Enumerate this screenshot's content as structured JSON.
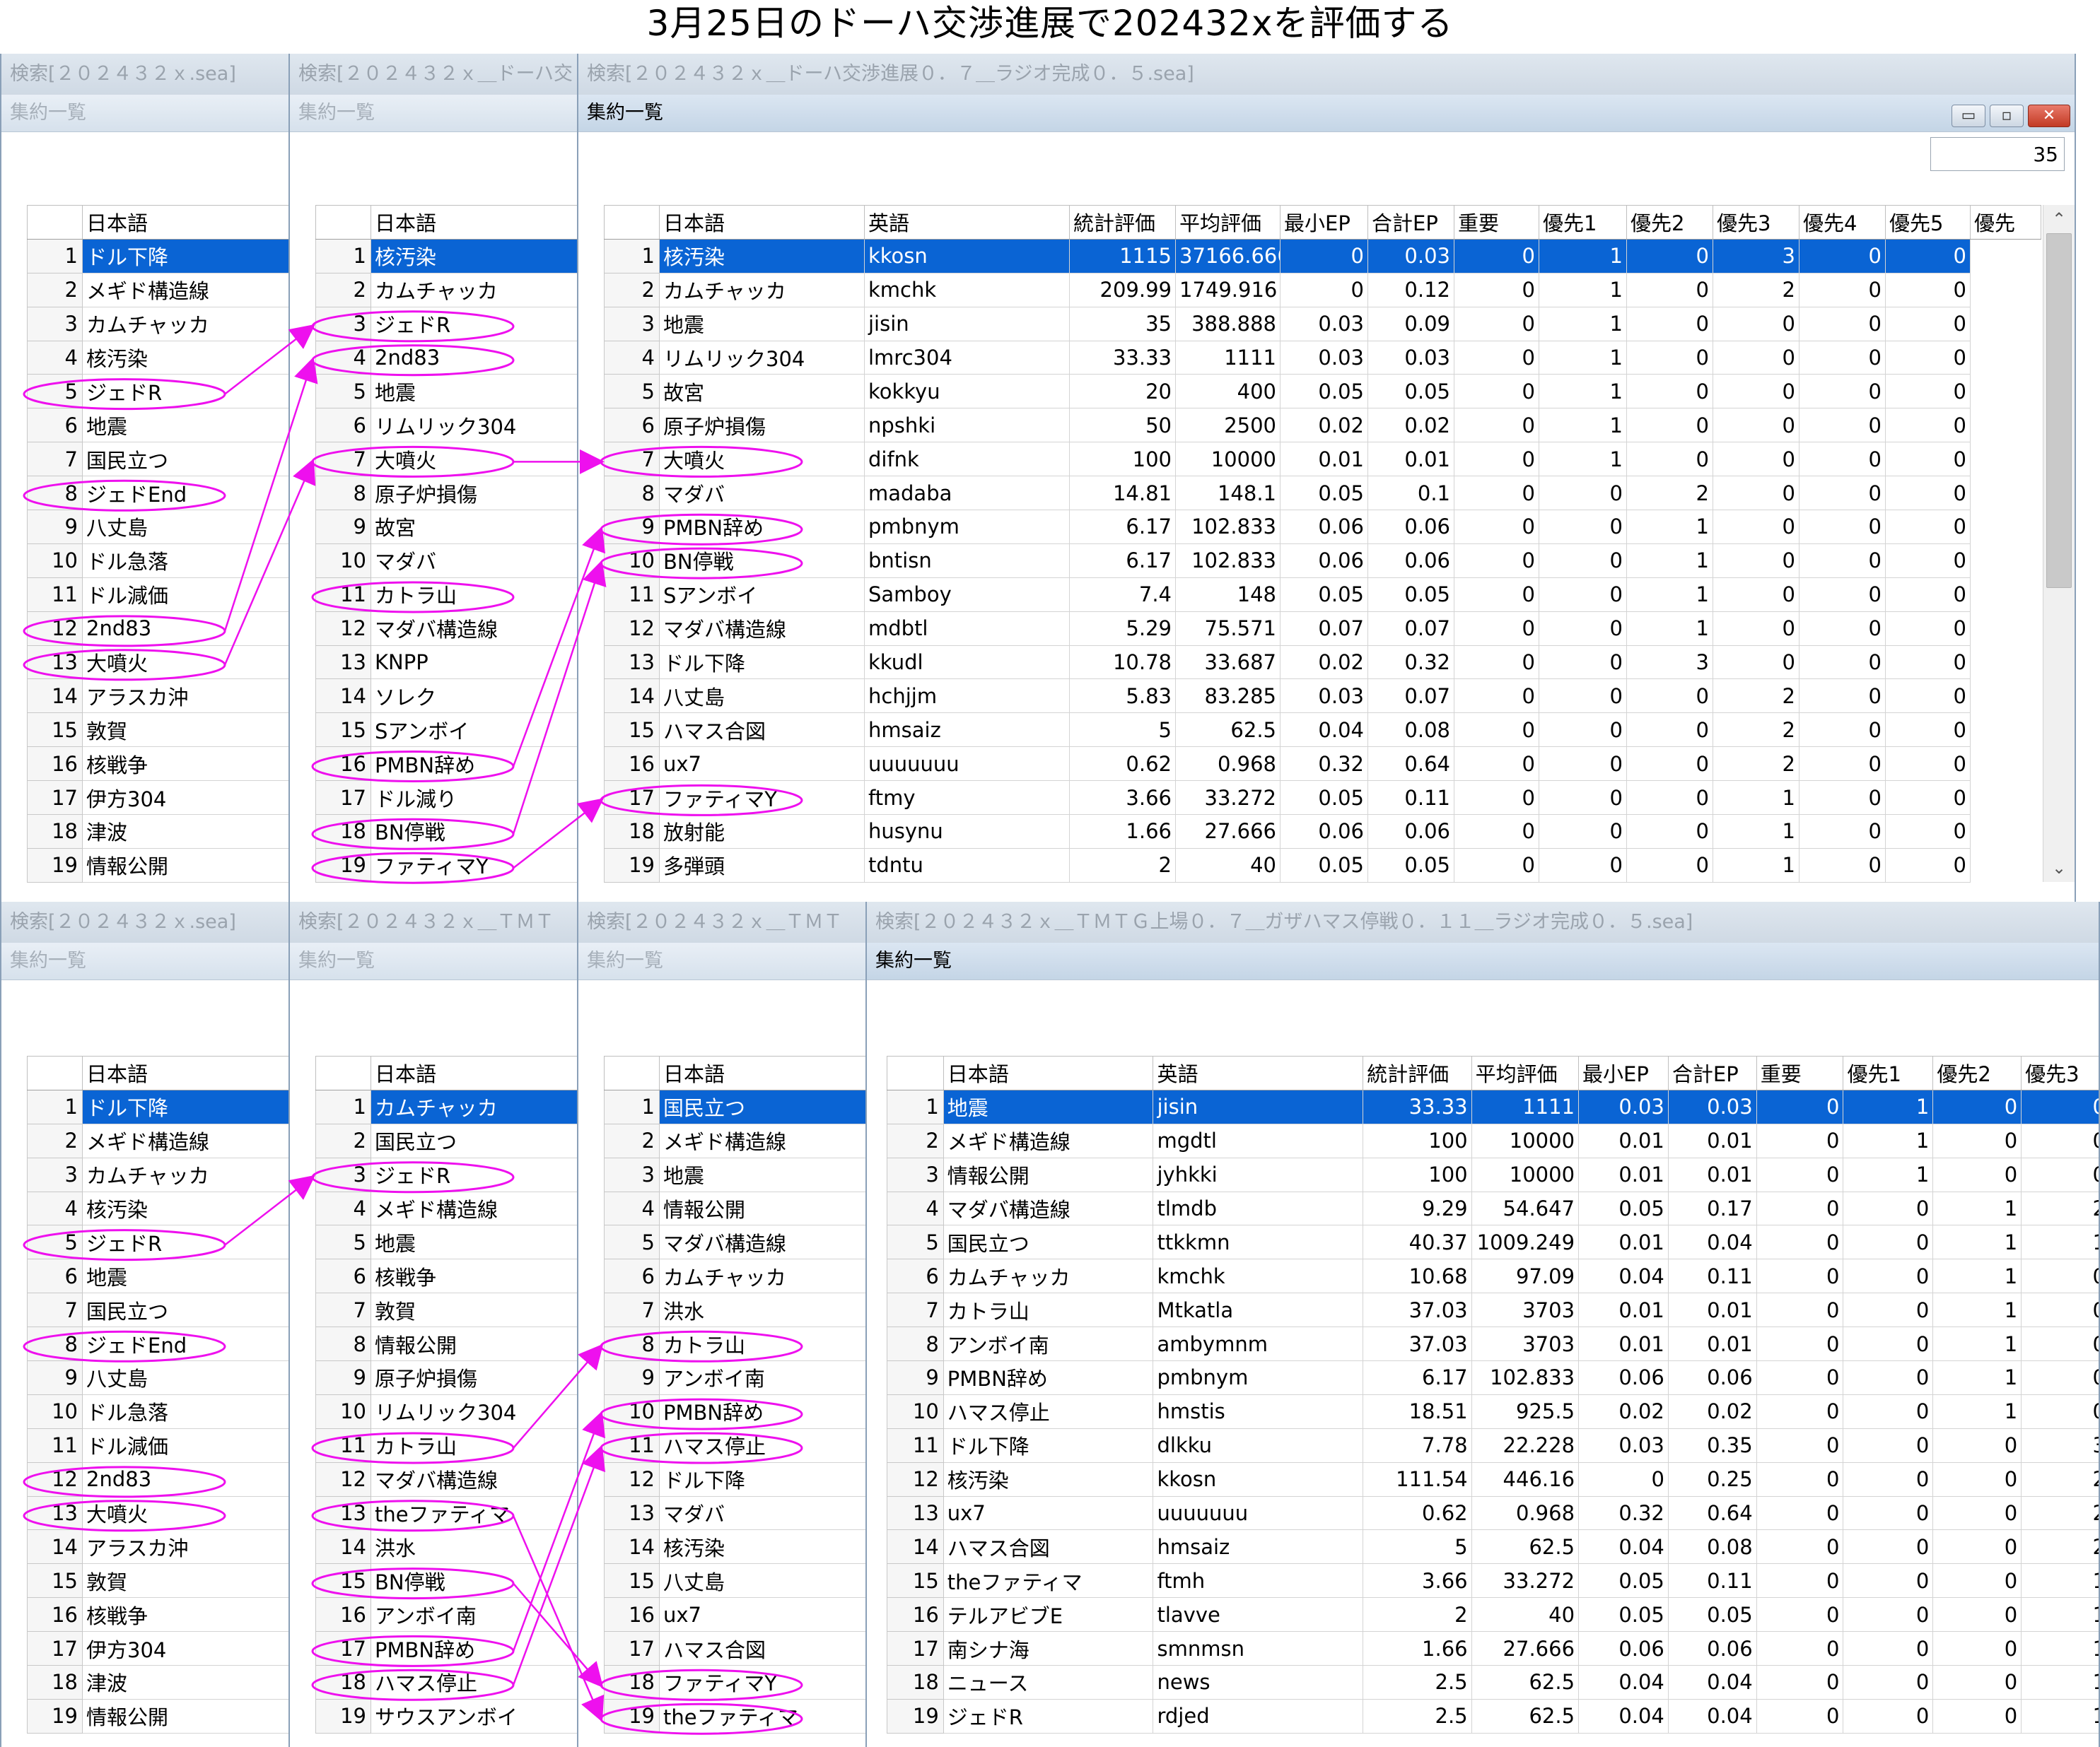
{
  "page_title": "3月25日のドーハ交渉進展で202432xを評価する",
  "summary_label": "集約一覧",
  "col_labels": {
    "rownum": "",
    "japanese": "日本語",
    "english": "英語",
    "stat": "統計評価",
    "avg": "平均評価",
    "minep": "最小EP",
    "sumep": "合計EP",
    "important": "重要",
    "p1": "優先1",
    "p2": "優先2",
    "p3": "優先3",
    "p4": "優先4",
    "p5": "優先5",
    "p6_partial": "優先"
  },
  "window_buttons": {
    "minimize": "▭",
    "maximize": "▫",
    "close": "✕"
  },
  "scroll_arrows": {
    "up": "⌃",
    "down": "⌄"
  },
  "windows": [
    {
      "id": "t1",
      "title": "検索[２０２４３２ｘ.sea]"
    },
    {
      "id": "t2",
      "title": "検索[２０２４３２ｘ＿ドーハ交"
    },
    {
      "id": "t3",
      "title": "検索[２０２４３２ｘ＿ドーハ交渉進展０．７＿ラジオ完成０．５.sea]",
      "count": "35"
    },
    {
      "id": "b1",
      "title": "検索[２０２４３２ｘ.sea]"
    },
    {
      "id": "b2",
      "title": "検索[２０２４３２ｘ＿ＴＭＴ"
    },
    {
      "id": "b3",
      "title": "検索[２０２４３２ｘ＿ＴＭＴ"
    },
    {
      "id": "b4",
      "title": "検索[２０２４３２ｘ＿ＴＭＴＧ上場０．７＿ガザハマス停戦０．１１＿ラジオ完成０．５.sea]"
    }
  ],
  "lists": {
    "base": [
      "ドル下降",
      "メギド構造線",
      "カムチャッカ",
      "核汚染",
      "ジェドR",
      "地震",
      "国民立つ",
      "ジェドEnd",
      "八丈島",
      "ドル急落",
      "ドル減価",
      "2nd83",
      "大噴火",
      "アラスカ沖",
      "敦賀",
      "核戦争",
      "伊方304",
      "津波",
      "情報公開"
    ],
    "t2": [
      "核汚染",
      "カムチャッカ",
      "ジェドR",
      "2nd83",
      "地震",
      "リムリック304",
      "大噴火",
      "原子炉損傷",
      "故宮",
      "マダバ",
      "カトラ山",
      "マダバ構造線",
      "KNPP",
      "ソレク",
      "Sアンボイ",
      "PMBN辞め",
      "ドル減り",
      "BN停戦",
      "ファティマY"
    ],
    "b2": [
      "カムチャッカ",
      "国民立つ",
      "ジェドR",
      "メギド構造線",
      "地震",
      "核戦争",
      "敦賀",
      "情報公開",
      "原子炉損傷",
      "リムリック304",
      "カトラ山",
      "マダバ構造線",
      "theファティマ",
      "洪水",
      "BN停戦",
      "アンボイ南",
      "PMBN辞め",
      "ハマス停止",
      "サウスアンボイ"
    ],
    "b3": [
      "国民立つ",
      "メギド構造線",
      "地震",
      "情報公開",
      "マダバ構造線",
      "カムチャッカ",
      "洪水",
      "カトラ山",
      "アンボイ南",
      "PMBN辞め",
      "ハマス停止",
      "ドル下降",
      "マダバ",
      "核汚染",
      "八丈島",
      "ux7",
      "ハマス合図",
      "ファティマY",
      "theファティマ"
    ]
  },
  "table_t3": [
    [
      "核汚染",
      "kkosn",
      "1115",
      "37166.666",
      "0",
      "0.03",
      "0",
      "1",
      "0",
      "3",
      "0",
      "0"
    ],
    [
      "カムチャッカ",
      "kmchk",
      "209.99",
      "1749.916",
      "0",
      "0.12",
      "0",
      "1",
      "0",
      "2",
      "0",
      "0"
    ],
    [
      "地震",
      "jisin",
      "35",
      "388.888",
      "0.03",
      "0.09",
      "0",
      "1",
      "0",
      "0",
      "0",
      "0"
    ],
    [
      "リムリック304",
      "lmrc304",
      "33.33",
      "1111",
      "0.03",
      "0.03",
      "0",
      "1",
      "0",
      "0",
      "0",
      "0"
    ],
    [
      "故宮",
      "kokkyu",
      "20",
      "400",
      "0.05",
      "0.05",
      "0",
      "1",
      "0",
      "0",
      "0",
      "0"
    ],
    [
      "原子炉損傷",
      "npshki",
      "50",
      "2500",
      "0.02",
      "0.02",
      "0",
      "1",
      "0",
      "0",
      "0",
      "0"
    ],
    [
      "大噴火",
      "difnk",
      "100",
      "10000",
      "0.01",
      "0.01",
      "0",
      "1",
      "0",
      "0",
      "0",
      "0"
    ],
    [
      "マダバ",
      "madaba",
      "14.81",
      "148.1",
      "0.05",
      "0.1",
      "0",
      "0",
      "2",
      "0",
      "0",
      "0"
    ],
    [
      "PMBN辞め",
      "pmbnym",
      "6.17",
      "102.833",
      "0.06",
      "0.06",
      "0",
      "0",
      "1",
      "0",
      "0",
      "0"
    ],
    [
      "BN停戦",
      "bntisn",
      "6.17",
      "102.833",
      "0.06",
      "0.06",
      "0",
      "0",
      "1",
      "0",
      "0",
      "0"
    ],
    [
      "Sアンボイ",
      "Samboy",
      "7.4",
      "148",
      "0.05",
      "0.05",
      "0",
      "0",
      "1",
      "0",
      "0",
      "0"
    ],
    [
      "マダバ構造線",
      "mdbtl",
      "5.29",
      "75.571",
      "0.07",
      "0.07",
      "0",
      "0",
      "1",
      "0",
      "0",
      "0"
    ],
    [
      "ドル下降",
      "kkudl",
      "10.78",
      "33.687",
      "0.02",
      "0.32",
      "0",
      "0",
      "3",
      "0",
      "0",
      "0"
    ],
    [
      "八丈島",
      "hchjjm",
      "5.83",
      "83.285",
      "0.03",
      "0.07",
      "0",
      "0",
      "0",
      "2",
      "0",
      "0"
    ],
    [
      "ハマス合図",
      "hmsaiz",
      "5",
      "62.5",
      "0.04",
      "0.08",
      "0",
      "0",
      "0",
      "2",
      "0",
      "0"
    ],
    [
      "ux7",
      "uuuuuuu",
      "0.62",
      "0.968",
      "0.32",
      "0.64",
      "0",
      "0",
      "0",
      "2",
      "0",
      "0"
    ],
    [
      "ファティマY",
      "ftmy",
      "3.66",
      "33.272",
      "0.05",
      "0.11",
      "0",
      "0",
      "0",
      "1",
      "0",
      "0"
    ],
    [
      "放射能",
      "husynu",
      "1.66",
      "27.666",
      "0.06",
      "0.06",
      "0",
      "0",
      "0",
      "1",
      "0",
      "0"
    ],
    [
      "多弾頭",
      "tdntu",
      "2",
      "40",
      "0.05",
      "0.05",
      "0",
      "0",
      "0",
      "1",
      "0",
      "0"
    ]
  ],
  "table_b4": [
    [
      "地震",
      "jisin",
      "33.33",
      "1111",
      "0.03",
      "0.03",
      "0",
      "1",
      "0",
      "0"
    ],
    [
      "メギド構造線",
      "mgdtl",
      "100",
      "10000",
      "0.01",
      "0.01",
      "0",
      "1",
      "0",
      "0"
    ],
    [
      "情報公開",
      "jyhkki",
      "100",
      "10000",
      "0.01",
      "0.01",
      "0",
      "1",
      "0",
      "0"
    ],
    [
      "マダバ構造線",
      "tlmdb",
      "9.29",
      "54.647",
      "0.05",
      "0.17",
      "0",
      "0",
      "1",
      "2"
    ],
    [
      "国民立つ",
      "ttkkmn",
      "40.37",
      "1009.249",
      "0.01",
      "0.04",
      "0",
      "0",
      "1",
      "1"
    ],
    [
      "カムチャッカ",
      "kmchk",
      "10.68",
      "97.09",
      "0.04",
      "0.11",
      "0",
      "0",
      "1",
      "0"
    ],
    [
      "カトラ山",
      "Mtkatla",
      "37.03",
      "3703",
      "0.01",
      "0.01",
      "0",
      "0",
      "1",
      "0"
    ],
    [
      "アンボイ南",
      "ambymnm",
      "37.03",
      "3703",
      "0.01",
      "0.01",
      "0",
      "0",
      "1",
      "0"
    ],
    [
      "PMBN辞め",
      "pmbnym",
      "6.17",
      "102.833",
      "0.06",
      "0.06",
      "0",
      "0",
      "1",
      "0"
    ],
    [
      "ハマス停止",
      "hmstis",
      "18.51",
      "925.5",
      "0.02",
      "0.02",
      "0",
      "0",
      "1",
      "0"
    ],
    [
      "ドル下降",
      "dlkku",
      "7.78",
      "22.228",
      "0.03",
      "0.35",
      "0",
      "0",
      "0",
      "3"
    ],
    [
      "核汚染",
      "kkosn",
      "111.54",
      "446.16",
      "0",
      "0.25",
      "0",
      "0",
      "0",
      "2"
    ],
    [
      "ux7",
      "uuuuuuu",
      "0.62",
      "0.968",
      "0.32",
      "0.64",
      "0",
      "0",
      "0",
      "2"
    ],
    [
      "ハマス合図",
      "hmsaiz",
      "5",
      "62.5",
      "0.04",
      "0.08",
      "0",
      "0",
      "0",
      "2"
    ],
    [
      "theファティマ",
      "ftmh",
      "3.66",
      "33.272",
      "0.05",
      "0.11",
      "0",
      "0",
      "0",
      "1"
    ],
    [
      "テルアビブE",
      "tlavve",
      "2",
      "40",
      "0.05",
      "0.05",
      "0",
      "0",
      "0",
      "1"
    ],
    [
      "南シナ海",
      "smnmsn",
      "1.66",
      "27.666",
      "0.06",
      "0.06",
      "0",
      "0",
      "0",
      "1"
    ],
    [
      "ニュース",
      "news",
      "2.5",
      "62.5",
      "0.04",
      "0.04",
      "0",
      "0",
      "0",
      "1"
    ],
    [
      "ジェドR",
      "rdjed",
      "2.5",
      "62.5",
      "0.04",
      "0.04",
      "0",
      "0",
      "0",
      "1"
    ]
  ],
  "annotation_color": "#ee10ee",
  "selection_color": "#0a64d4"
}
